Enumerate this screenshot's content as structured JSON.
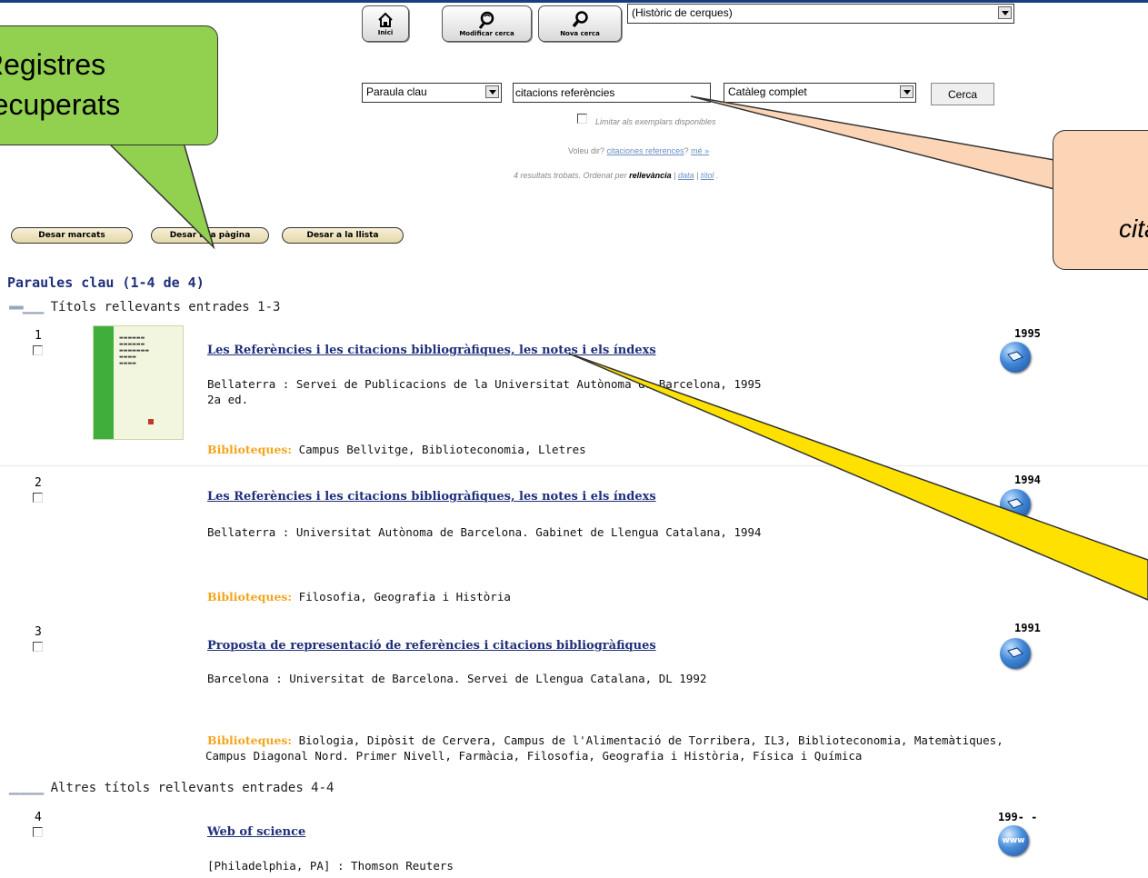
{
  "toolbar": {
    "home_label": "Inici",
    "modify_label": "Modificar cerca",
    "new_label": "Nova cerca",
    "history_select": "(Històric de cerques)"
  },
  "search": {
    "field_select": "Paraula clau",
    "query": "citacions referències",
    "scope_select": "Catàleg complet",
    "submit_label": "Cerca",
    "limit_label": "Limitar als exemplars disponibles",
    "didyoumean_prefix": "Voleu dir?",
    "didyoumean_link": "citaciones references",
    "didyoumean_more": "mé »",
    "results_prefix": "4 resultats trobats. Ordenat per",
    "sort_active": "rellevància",
    "sort_date": "data",
    "sort_title": "títol"
  },
  "actions": {
    "save_marked": "Desar marcats",
    "save_page": "Desar a la pàgina",
    "save_list": "Desar a la llista"
  },
  "results": {
    "heading": "Paraules clau (1-4 de 4)",
    "group1": "Títols rellevants entrades 1-3",
    "group2": "Altres títols rellevants entrades 4-4",
    "libraries_label": "Biblioteques:",
    "items": [
      {
        "num": "1",
        "title": "Les Referències i les citacions bibliogràfiques, les notes i els índexs",
        "publisher": "Bellaterra : Servei de Publicacions de la Universitat Autònoma de Barcelona, 1995",
        "edition": "2a ed.",
        "libraries": "Campus Bellvitge, Biblioteconomia, Lletres",
        "year": "1995"
      },
      {
        "num": "2",
        "title": "Les Referències i les citacions bibliogràfiques, les notes i els índexs",
        "publisher": "Bellaterra : Universitat Autònoma de Barcelona. Gabinet de Llengua Catalana, 1994",
        "libraries": "Filosofia, Geografia i Història",
        "year": "1994"
      },
      {
        "num": "3",
        "title": "Proposta de representació de referències i citacions bibliogràfiques",
        "publisher": "Barcelona : Universitat de Barcelona. Servei de Llengua Catalana, DL 1992",
        "libraries_line1": "Biologia, Dipòsit de Cervera, Campus de l'Alimentació de Torribera, IL3, Biblioteconomia, Matemàtiques,",
        "libraries_line2": "Campus Diagonal Nord. Primer Nivell, Farmàcia, Filosofia, Geografia i Història, Física i Química",
        "year": "1991"
      },
      {
        "num": "4",
        "title": "Web of science",
        "publisher": "[Philadelphia, PA] : Thomson Reuters",
        "year": "199- -",
        "icon_text": "www"
      }
    ]
  },
  "callouts": {
    "green_line1": "Registres",
    "green_line2": "recuperats",
    "orange_text": "cita"
  },
  "colors": {
    "green_callout": "#92d050",
    "orange_callout": "#fbd5b5",
    "link_blue": "#1f2f7a",
    "library_orange": "#f4a51c"
  }
}
